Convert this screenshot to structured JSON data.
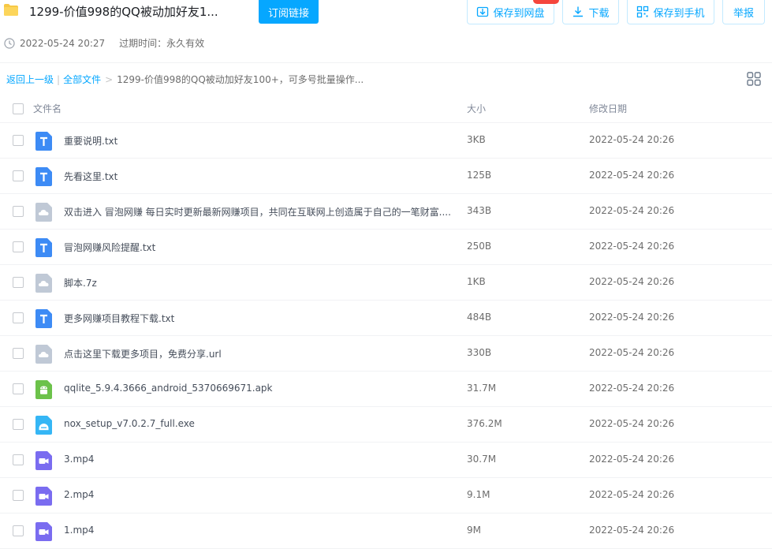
{
  "header": {
    "title": "1299-价值998的QQ被动加好友1...",
    "subscribe_label": "订阅链接",
    "save_to_netdisk_label": "保存到网盘",
    "download_label": "下载",
    "save_to_phone_label": "保存到手机",
    "report_label": "举报",
    "date": "2022-05-24 20:27",
    "expire": "过期时间：永久有效"
  },
  "breadcrumb": {
    "back": "返回上一级",
    "all_files": "全部文件",
    "separator": ">",
    "current": "1299-价值998的QQ被动加好友100+，可多号批量操作..."
  },
  "table": {
    "col_name": "文件名",
    "col_size": "大小",
    "col_date": "修改日期",
    "rows": [
      {
        "name": "重要说明.txt",
        "size": "3KB",
        "date": "2022-05-24 20:26",
        "icon": "txt"
      },
      {
        "name": "先看这里.txt",
        "size": "125B",
        "date": "2022-05-24 20:26",
        "icon": "txt"
      },
      {
        "name": "双击进入 冒泡网赚 每日实时更新最新网赚项目，共同在互联网上创造属于自己的一笔财富....",
        "size": "343B",
        "date": "2022-05-24 20:26",
        "icon": "cloud"
      },
      {
        "name": "冒泡网赚风险提醒.txt",
        "size": "250B",
        "date": "2022-05-24 20:26",
        "icon": "txt"
      },
      {
        "name": "脚本.7z",
        "size": "1KB",
        "date": "2022-05-24 20:26",
        "icon": "cloud"
      },
      {
        "name": "更多网赚项目教程下载.txt",
        "size": "484B",
        "date": "2022-05-24 20:26",
        "icon": "txt"
      },
      {
        "name": "点击这里下载更多项目，免费分享.url",
        "size": "330B",
        "date": "2022-05-24 20:26",
        "icon": "cloud"
      },
      {
        "name": "qqlite_5.9.4.3666_android_5370669671.apk",
        "size": "31.7M",
        "date": "2022-05-24 20:26",
        "icon": "apk"
      },
      {
        "name": "nox_setup_v7.0.2.7_full.exe",
        "size": "376.2M",
        "date": "2022-05-24 20:26",
        "icon": "exe"
      },
      {
        "name": "3.mp4",
        "size": "30.7M",
        "date": "2022-05-24 20:26",
        "icon": "video"
      },
      {
        "name": "2.mp4",
        "size": "9.1M",
        "date": "2022-05-24 20:26",
        "icon": "video"
      },
      {
        "name": "1.mp4",
        "size": "9M",
        "date": "2022-05-24 20:26",
        "icon": "video"
      }
    ]
  },
  "colors": {
    "accent": "#06a7ff",
    "badge": "#f5463d",
    "txt_icon": "#3d8bf5",
    "cloud_icon": "#c0c9d6",
    "apk_icon": "#6cc24a",
    "exe_icon": "#35b6f5",
    "video_icon": "#7a6cf0"
  }
}
